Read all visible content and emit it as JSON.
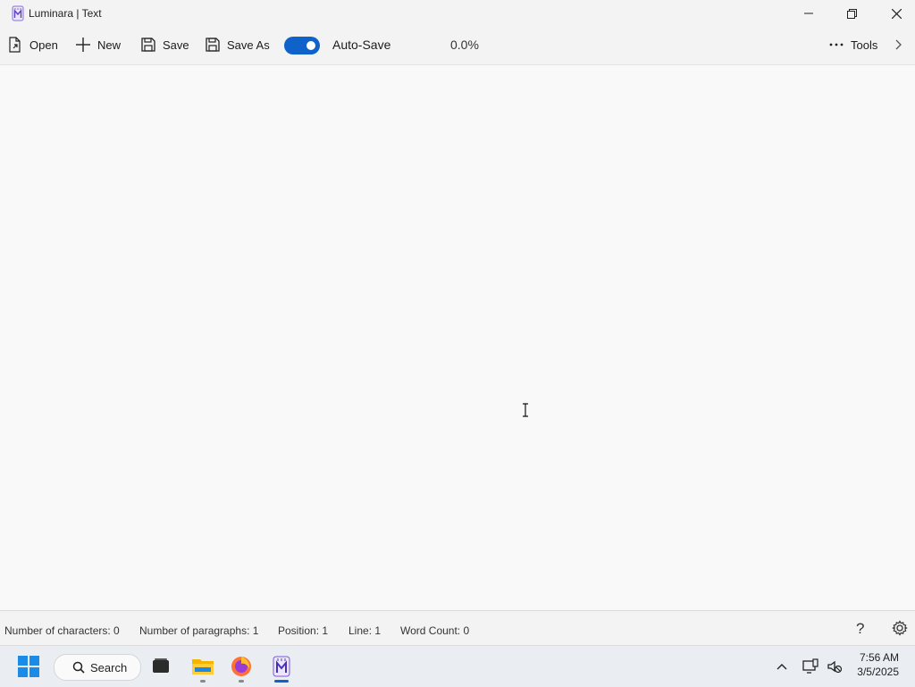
{
  "window": {
    "title": "Luminara | Text"
  },
  "toolbar": {
    "open_label": "Open",
    "new_label": "New",
    "save_label": "Save",
    "save_as_label": "Save As",
    "autosave_label": "Auto-Save",
    "autosave_on": true,
    "progress_text": "0.0%",
    "tools_label": "Tools"
  },
  "status": {
    "characters": "Number of characters: 0",
    "paragraphs": "Number of paragraphs: 1",
    "position": "Position: 1",
    "line": "Line: 1",
    "words": "Word Count: 0",
    "help": "?"
  },
  "taskbar": {
    "search_label": "Search",
    "time": "7:56 AM",
    "date": "3/5/2025"
  },
  "colors": {
    "accent": "#0f62c9",
    "background": "#f9f9f9",
    "chrome": "#f3f3f3"
  }
}
